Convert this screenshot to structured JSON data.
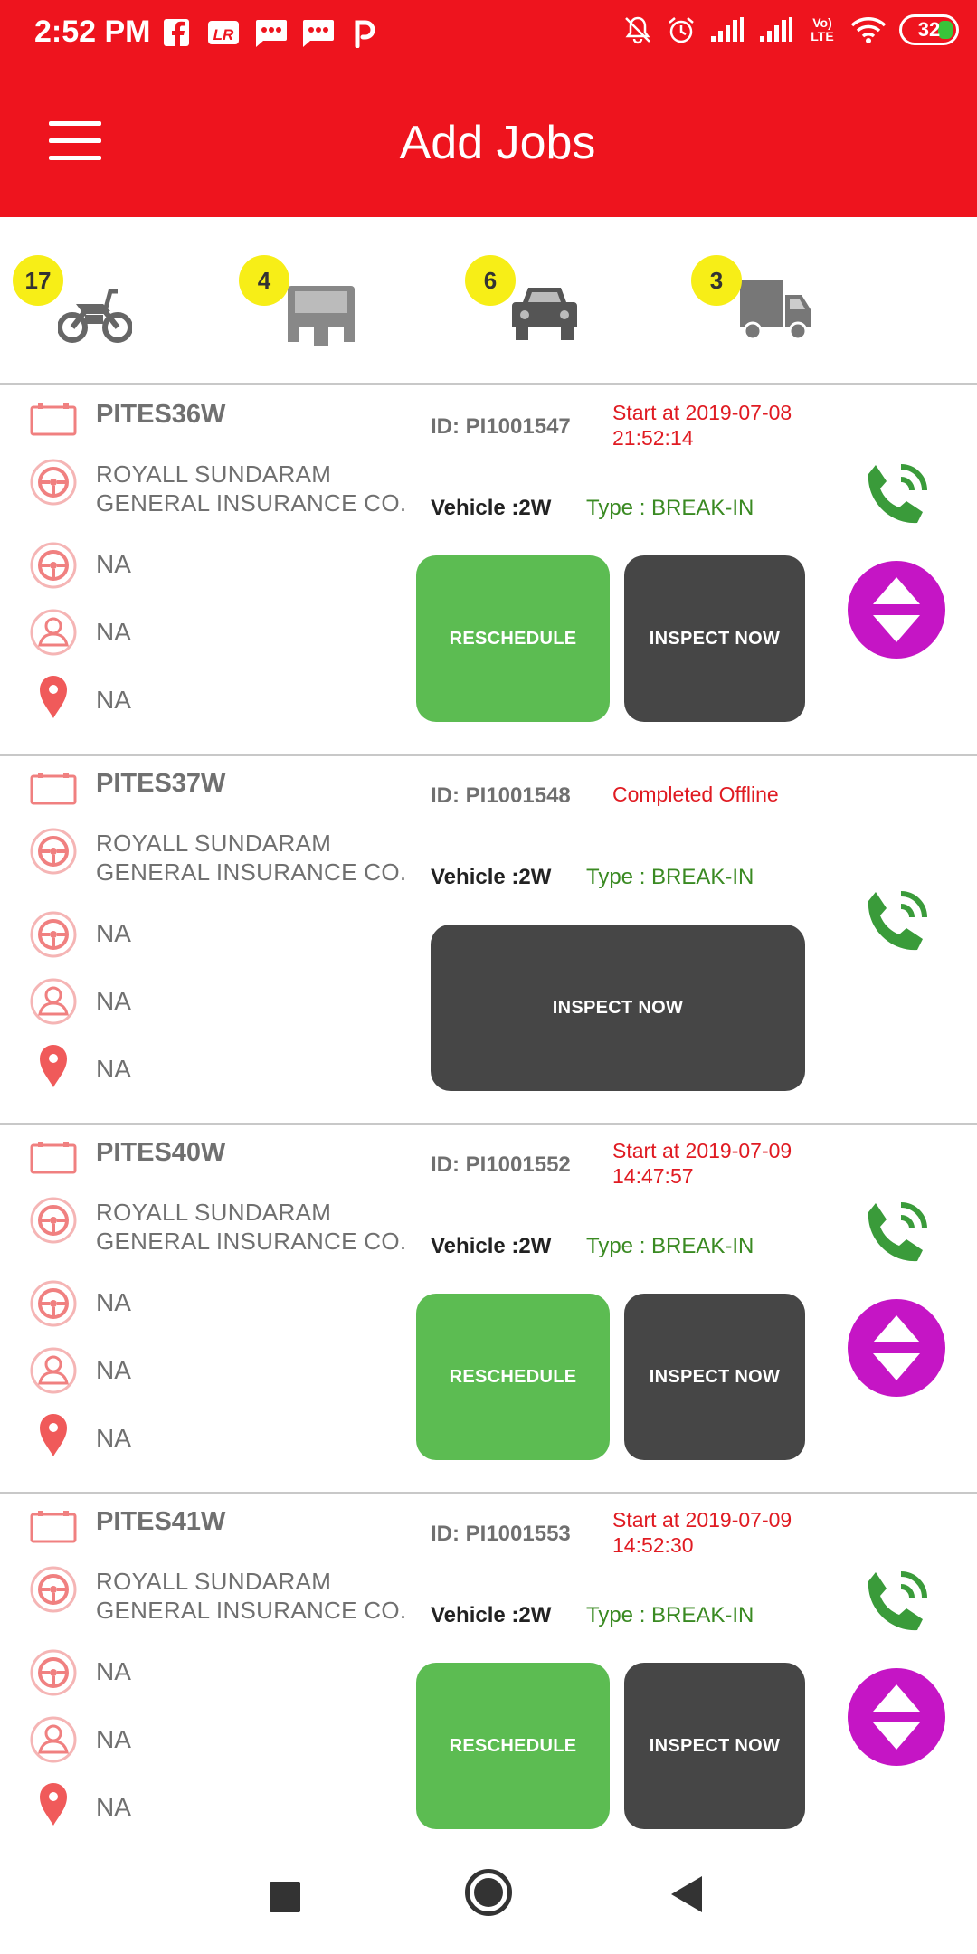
{
  "status_bar": {
    "time": "2:52 PM",
    "left_icons": [
      "facebook-icon",
      "lr-app-icon",
      "message-icon",
      "message-icon",
      "paytm-icon"
    ],
    "right_icons": [
      "mute-icon",
      "alarm-icon",
      "signal-icon",
      "signal-icon",
      "volte-icon",
      "wifi-icon"
    ],
    "volte": "Vo) LTE",
    "battery": "32"
  },
  "app_bar": {
    "title": "Add Jobs",
    "menu_icon": "hamburger-menu-icon",
    "color": "#ee141e"
  },
  "categories": [
    {
      "name": "two-wheeler",
      "icon": "motorcycle-icon",
      "count": "17"
    },
    {
      "name": "three-wheeler",
      "icon": "auto-rickshaw-icon",
      "count": "4"
    },
    {
      "name": "four-wheeler",
      "icon": "car-icon",
      "count": "6"
    },
    {
      "name": "commercial",
      "icon": "truck-icon",
      "count": "3"
    }
  ],
  "jobs": [
    {
      "plate": "PITES36W",
      "insurer_line1": "ROYALL SUNDARAM",
      "insurer_line2": "GENERAL INSURANCE CO.",
      "field1": "NA",
      "field2": "NA",
      "field3": "NA",
      "id": "ID: PI1001547",
      "status_line1": "Start at 2019-07-08",
      "status_line2": "21:52:14",
      "vehicle": "Vehicle :2W",
      "type": "Type : BREAK-IN",
      "reschedule": "RESCHEDULE",
      "inspect": "INSPECT NOW"
    },
    {
      "plate": "PITES37W",
      "insurer_line1": "ROYALL SUNDARAM",
      "insurer_line2": "GENERAL INSURANCE CO.",
      "field1": "NA",
      "field2": "NA",
      "field3": "NA",
      "id": "ID: PI1001548",
      "status_line1": "Completed Offline",
      "status_line2": "",
      "vehicle": "Vehicle :2W",
      "type": "Type : BREAK-IN",
      "inspect": "INSPECT NOW"
    },
    {
      "plate": "PITES40W",
      "insurer_line1": "ROYALL SUNDARAM",
      "insurer_line2": "GENERAL INSURANCE CO.",
      "field1": "NA",
      "field2": "NA",
      "field3": "NA",
      "id": "ID: PI1001552",
      "status_line1": "Start at 2019-07-09",
      "status_line2": "14:47:57",
      "vehicle": "Vehicle :2W",
      "type": "Type : BREAK-IN",
      "reschedule": "RESCHEDULE",
      "inspect": "INSPECT NOW"
    },
    {
      "plate": "PITES41W",
      "insurer_line1": "ROYALL SUNDARAM",
      "insurer_line2": "GENERAL INSURANCE CO.",
      "field1": "NA",
      "field2": "NA",
      "field3": "NA",
      "id": "ID: PI1001553",
      "status_line1": "Start at 2019-07-09",
      "status_line2": "14:52:30",
      "vehicle": "Vehicle :2W",
      "type": "Type : BREAK-IN",
      "reschedule": "RESCHEDULE",
      "inspect": "INSPECT NOW"
    }
  ],
  "row_icons": [
    "license-plate-icon",
    "steering-wheel-icon",
    "steering-wheel-icon",
    "person-icon",
    "location-pin-icon"
  ],
  "colors": {
    "accent_red": "#ee141e",
    "reschedule_green": "#5cbc52",
    "inspect_dark": "#464646",
    "phone_green": "#3a9b3a",
    "toggle_purple": "#c515c5",
    "badge_yellow": "#f7ee17",
    "status_red": "#e01b22",
    "type_green": "#3a8a22"
  },
  "nav_bar": {
    "icons": [
      "recent-apps-icon",
      "home-icon",
      "back-icon"
    ]
  }
}
